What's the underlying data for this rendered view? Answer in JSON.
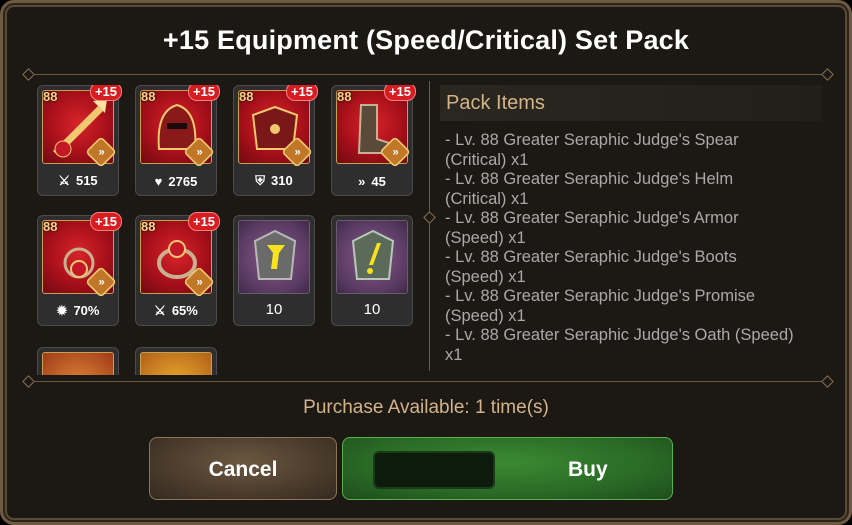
{
  "dialog": {
    "title": "+15 Equipment (Speed/Critical) Set Pack"
  },
  "items": [
    {
      "name": "spear",
      "level": "88",
      "plus": "+15",
      "stat_icon": "sword-icon",
      "stat": "515"
    },
    {
      "name": "helm",
      "level": "88",
      "plus": "+15",
      "stat_icon": "heart-icon",
      "stat": "2765"
    },
    {
      "name": "armor",
      "level": "88",
      "plus": "+15",
      "stat_icon": "shield-icon",
      "stat": "310"
    },
    {
      "name": "boots",
      "level": "88",
      "plus": "+15",
      "stat_icon": "speed-icon",
      "stat": "45"
    },
    {
      "name": "promise",
      "level": "88",
      "plus": "+15",
      "stat_icon": "crit-icon",
      "stat": "70%"
    },
    {
      "name": "oath",
      "level": "88",
      "plus": "+15",
      "stat_icon": "sword-icon",
      "stat": "65%"
    },
    {
      "name": "charm-yellow",
      "count": "10"
    },
    {
      "name": "charm-green",
      "count": "10"
    }
  ],
  "pack": {
    "title": "Pack Items",
    "lines": [
      "- Lv. 88 Greater Seraphic Judge's Spear",
      "(Critical) x1",
      "- Lv. 88 Greater Seraphic Judge's Helm",
      "(Critical) x1",
      "- Lv. 88 Greater Seraphic Judge's Armor",
      "(Speed) x1",
      "- Lv. 88 Greater Seraphic Judge's Boots",
      "(Speed) x1",
      "- Lv. 88 Greater Seraphic Judge's Promise",
      "(Speed) x1",
      "- Lv. 88 Greater Seraphic Judge's Oath (Speed)",
      "x1"
    ]
  },
  "purchase_text": "Purchase Available: 1 time(s)",
  "buttons": {
    "cancel": "Cancel",
    "buy": "Buy"
  }
}
